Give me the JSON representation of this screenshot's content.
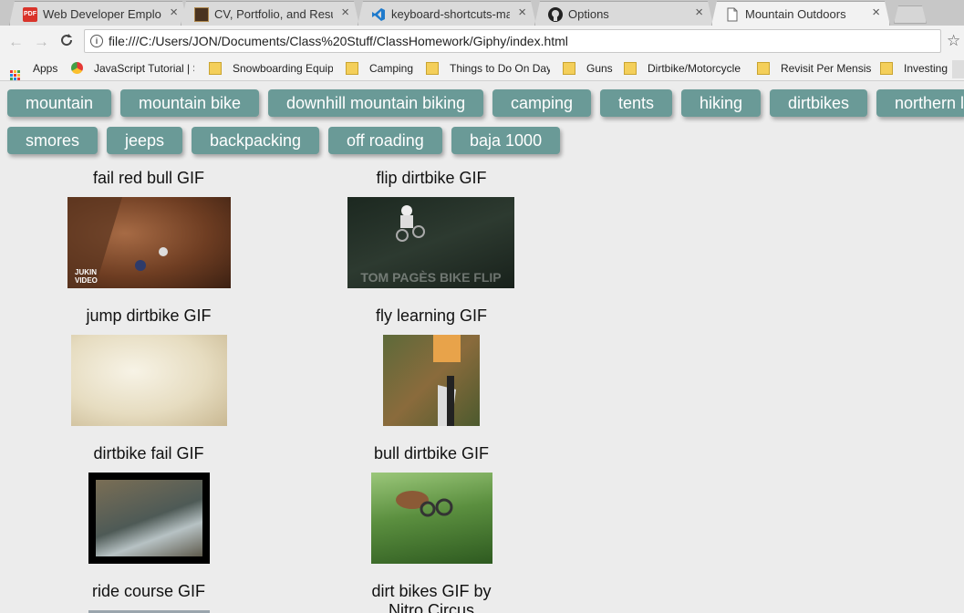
{
  "tabs": [
    {
      "title": "Web Developer Employer",
      "icon": "pdf-icon"
    },
    {
      "title": "CV, Portfolio, and Resume",
      "icon": "document-icon"
    },
    {
      "title": "keyboard-shortcuts-mac",
      "icon": "vscode-icon"
    },
    {
      "title": "Options",
      "icon": "github-icon"
    },
    {
      "title": "Mountain Outdoors",
      "icon": "page-icon"
    }
  ],
  "toolbar": {
    "url": "file:///C:/Users/JON/Documents/Class%20Stuff/ClassHomework/Giphy/index.html",
    "back_icon": "arrow-left-icon",
    "forward_icon": "arrow-right-icon",
    "reload_icon": "reload-icon",
    "star_icon": "star-icon"
  },
  "bookmarks": [
    {
      "title": "Apps",
      "icon": "apps-grid-icon"
    },
    {
      "title": "JavaScript Tutorial | S",
      "icon": "chrome-icon"
    },
    {
      "title": "Snowboarding Equip",
      "icon": "folder-icon"
    },
    {
      "title": "Camping",
      "icon": "folder-icon"
    },
    {
      "title": "Things to Do On Day",
      "icon": "folder-icon"
    },
    {
      "title": "Guns",
      "icon": "folder-icon"
    },
    {
      "title": "Dirtbike/Motorcycle",
      "icon": "folder-icon"
    },
    {
      "title": "Revisit Per Mensis",
      "icon": "folder-icon"
    },
    {
      "title": "Investing",
      "icon": "folder-icon"
    }
  ],
  "topics": [
    "mountain",
    "mountain bike",
    "downhill mountain biking",
    "camping",
    "tents",
    "hiking",
    "dirtbikes",
    "northern l",
    "smores",
    "jeeps",
    "backpacking",
    "off roading",
    "baja 1000"
  ],
  "gifs": [
    {
      "caption": "fail red bull GIF",
      "overlay": "JUKIN VIDEO"
    },
    {
      "caption": "flip dirtbike GIF",
      "overlay": "TOM PAGÈS BIKE FLIP"
    },
    {
      "caption": "jump dirtbike GIF",
      "overlay": ""
    },
    {
      "caption": "fly learning GIF",
      "overlay": ""
    },
    {
      "caption": "dirtbike fail GIF",
      "overlay": ""
    },
    {
      "caption": "bull dirtbike GIF",
      "overlay": ""
    },
    {
      "caption": "ride course GIF",
      "overlay": ""
    },
    {
      "caption": "dirt bikes GIF by Nitro Circus",
      "overlay": ""
    }
  ],
  "colors": {
    "topic_button": "#6a9a97",
    "page_background": "#ececec"
  }
}
